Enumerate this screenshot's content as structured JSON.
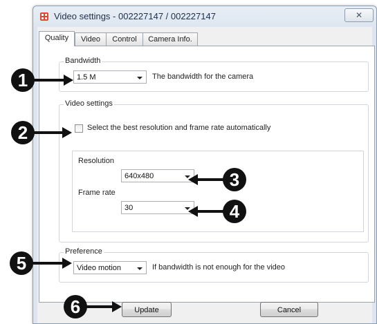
{
  "window": {
    "title": "Video settings - 002227147 / 002227147",
    "close_glyph": "✕"
  },
  "tabs": [
    {
      "label": "Quality"
    },
    {
      "label": "Video"
    },
    {
      "label": "Control"
    },
    {
      "label": "Camera Info."
    }
  ],
  "bandwidth": {
    "group_label": "Bandwidth",
    "value": "1.5 M",
    "description": "The bandwidth for the camera"
  },
  "video_settings": {
    "group_label": "Video settings",
    "auto_checkbox_label": "Select the best resolution and frame rate automatically",
    "auto_checked": false,
    "resolution_label": "Resolution",
    "resolution_value": "640x480",
    "frame_rate_label": "Frame rate",
    "frame_rate_value": "30"
  },
  "preference": {
    "group_label": "Preference",
    "value": "Video motion",
    "description": "If bandwidth is not enough for the video"
  },
  "buttons": {
    "update": "Update",
    "cancel": "Cancel"
  },
  "callouts": [
    "1",
    "2",
    "3",
    "4",
    "5",
    "6"
  ]
}
